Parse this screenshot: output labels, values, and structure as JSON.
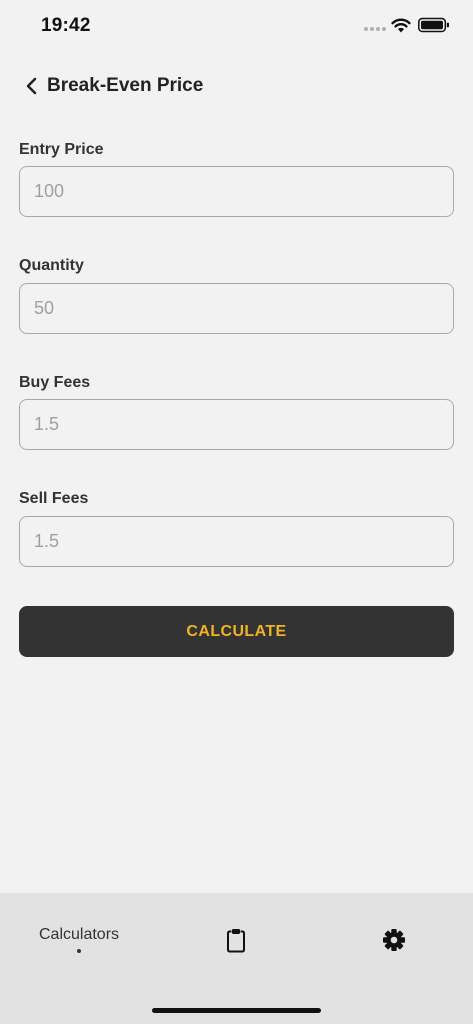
{
  "status_bar": {
    "time": "19:42",
    "icons": [
      "signal-dots-icon",
      "wifi-icon",
      "battery-icon"
    ]
  },
  "header": {
    "back_icon": "chevron-left-icon",
    "title": "Break-Even Price"
  },
  "form": {
    "fields": [
      {
        "label": "Entry Price",
        "placeholder": "100",
        "value": ""
      },
      {
        "label": "Quantity",
        "placeholder": "50",
        "value": ""
      },
      {
        "label": "Buy Fees",
        "placeholder": "1.5",
        "value": ""
      },
      {
        "label": "Sell Fees",
        "placeholder": "1.5",
        "value": ""
      }
    ],
    "submit_label": "CALCULATE"
  },
  "tab_bar": {
    "items": [
      {
        "label": "Calculators",
        "active": true
      },
      {
        "icon": "clipboard-icon",
        "active": false
      },
      {
        "icon": "gear-icon",
        "active": false
      }
    ]
  },
  "colors": {
    "background": "#f2f2f2",
    "button_background": "#333333",
    "button_text": "#f0b323",
    "tab_bar_background": "#e2e2e2",
    "input_border": "#a9a9a9",
    "placeholder_text": "#a0a0a0"
  }
}
